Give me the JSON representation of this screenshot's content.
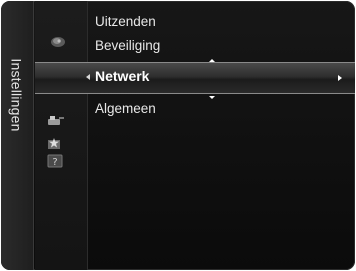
{
  "side_tab": {
    "label": "Instellingen"
  },
  "menu": {
    "items": [
      {
        "label": "Uitzenden",
        "icon": "satellite-dish-icon"
      },
      {
        "label": "Beveiliging",
        "icon": "lock-icon"
      },
      {
        "label": "Netwerk",
        "icon": "gear-icon",
        "selected": true
      },
      {
        "label": "Algemeen",
        "icon": "toolbox-icon"
      }
    ]
  },
  "extra_icons": [
    "star-screen-icon",
    "help-icon"
  ],
  "colors": {
    "background": "#121212",
    "highlight": "#3a3a3a",
    "text": "#e8e8e8",
    "selected_text": "#ffffff"
  }
}
